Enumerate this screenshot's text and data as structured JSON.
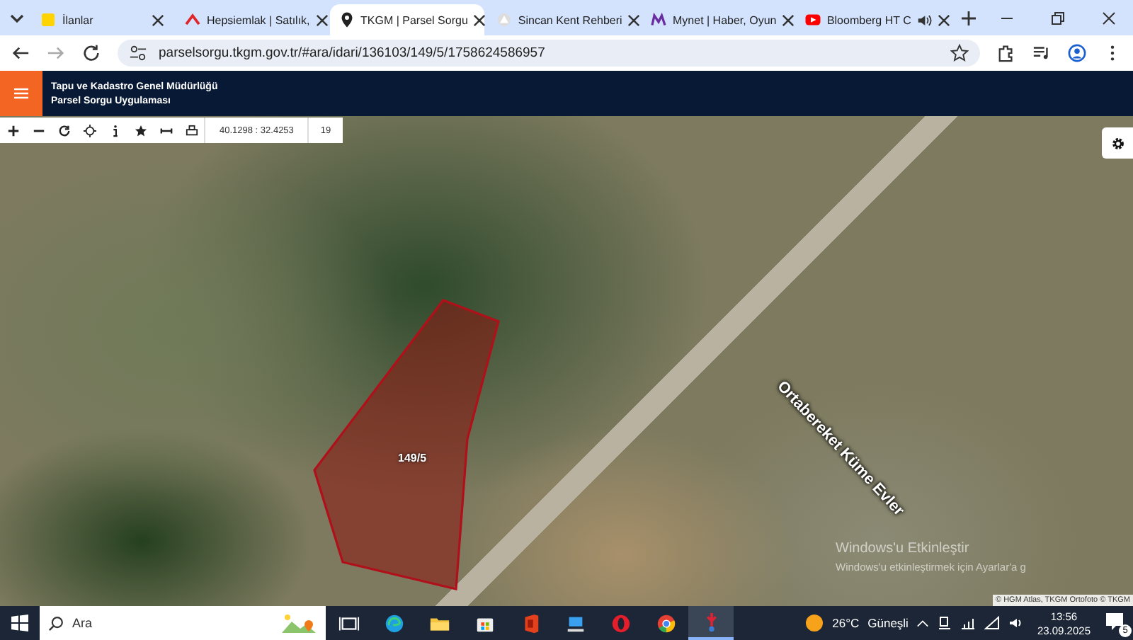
{
  "browser": {
    "tabs": [
      {
        "title": "İlanlar",
        "selected": false,
        "audio": false
      },
      {
        "title": "Hepsiemlak | Satılık,",
        "selected": false,
        "audio": false
      },
      {
        "title": "TKGM | Parsel Sorgu",
        "selected": true,
        "audio": false
      },
      {
        "title": "Sincan Kent Rehberi",
        "selected": false,
        "audio": false
      },
      {
        "title": "Mynet | Haber, Oyun",
        "selected": false,
        "audio": false
      },
      {
        "title": "Bloomberg HT C",
        "selected": false,
        "audio": true
      }
    ],
    "url": "parselsorgu.tkgm.gov.tr/#ara/idari/136103/149/5/1758624586957"
  },
  "app": {
    "title": "Tapu ve Kadastro Genel Müdürlüğü",
    "subtitle": "Parsel Sorgu Uygulaması"
  },
  "map_toolbar": {
    "coordinates": "40.1298 : 32.4253",
    "zoom": "19"
  },
  "map": {
    "parcel_label": "149/5",
    "road_label": "Ortabereket Küme Evler",
    "attribution": "© HGM Atlas, TKGM Ortofoto © TKGM"
  },
  "activation": {
    "title": "Windows'u Etkinleştir",
    "text": "Windows'u etkinleştirmek için Ayarlar'a g"
  },
  "taskbar": {
    "search_placeholder": "Ara",
    "apps": [
      {
        "kind": "taskview",
        "active": false
      },
      {
        "kind": "edge",
        "active": false
      },
      {
        "kind": "explorer",
        "active": false
      },
      {
        "kind": "store",
        "active": false
      },
      {
        "kind": "office",
        "active": false
      },
      {
        "kind": "computer",
        "active": false
      },
      {
        "kind": "opera",
        "active": false
      },
      {
        "kind": "chrome",
        "active": false
      },
      {
        "kind": "pin",
        "active": true
      }
    ],
    "temperature": "26°C",
    "condition": "Güneşli",
    "time": "13:56",
    "date": "23.09.2025",
    "notifications": "5"
  }
}
